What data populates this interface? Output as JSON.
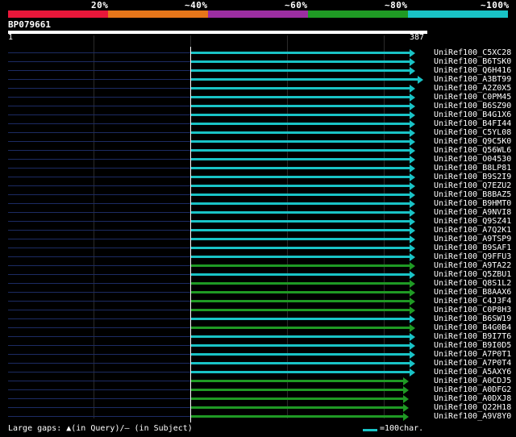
{
  "header": {
    "pct_labels": [
      "20%",
      "~40%",
      "~60%",
      "~80%",
      "~100%"
    ],
    "colors": [
      "#e8173a",
      "#e6761a",
      "#9c2ea1",
      "#1f9a24",
      "#19c3c6"
    ]
  },
  "query": {
    "id": "BP079661",
    "start": "1",
    "end": "387"
  },
  "hits": [
    {
      "label": "UniRef100_C5XC28",
      "color": "#19c3c6"
    },
    {
      "label": "UniRef100_B6TSK0",
      "color": "#19c3c6"
    },
    {
      "label": "UniRef100_Q6H416",
      "color": "#19c3c6"
    },
    {
      "label": "UniRef100_A3BT99",
      "color": "#19c3c6"
    },
    {
      "label": "UniRef100_A2Z0X5",
      "color": "#19c3c6"
    },
    {
      "label": "UniRef100_C0PM45",
      "color": "#19c3c6"
    },
    {
      "label": "UniRef100_B6SZ90",
      "color": "#19c3c6"
    },
    {
      "label": "UniRef100_B4G1X6",
      "color": "#19c3c6"
    },
    {
      "label": "UniRef100_B4FI44",
      "color": "#19c3c6"
    },
    {
      "label": "UniRef100_C5YL08",
      "color": "#19c3c6"
    },
    {
      "label": "UniRef100_Q9C5K0",
      "color": "#19c3c6"
    },
    {
      "label": "UniRef100_Q56WL6",
      "color": "#19c3c6"
    },
    {
      "label": "UniRef100_O04530",
      "color": "#19c3c6"
    },
    {
      "label": "UniRef100_B8LP81",
      "color": "#19c3c6"
    },
    {
      "label": "UniRef100_B9S2I9",
      "color": "#19c3c6"
    },
    {
      "label": "UniRef100_Q7EZU2",
      "color": "#19c3c6"
    },
    {
      "label": "UniRef100_B8BAZ5",
      "color": "#19c3c6"
    },
    {
      "label": "UniRef100_B9HMT0",
      "color": "#19c3c6"
    },
    {
      "label": "UniRef100_A9NVI8",
      "color": "#19c3c6"
    },
    {
      "label": "UniRef100_Q9SZ41",
      "color": "#19c3c6"
    },
    {
      "label": "UniRef100_A7Q2K1",
      "color": "#19c3c6"
    },
    {
      "label": "UniRef100_A9TSP9",
      "color": "#19c3c6"
    },
    {
      "label": "UniRef100_B9SAF1",
      "color": "#19c3c6"
    },
    {
      "label": "UniRef100_Q9FFU3",
      "color": "#19c3c6"
    },
    {
      "label": "UniRef100_A9TA22",
      "color": "#1f9a24"
    },
    {
      "label": "UniRef100_Q5ZBU1",
      "color": "#19c3c6"
    },
    {
      "label": "UniRef100_Q8S1L2",
      "color": "#1f9a24"
    },
    {
      "label": "UniRef100_B8AAX6",
      "color": "#1f9a24"
    },
    {
      "label": "UniRef100_C4J3F4",
      "color": "#1f9a24"
    },
    {
      "label": "UniRef100_C0P8H3",
      "color": "#1f9a24"
    },
    {
      "label": "UniRef100_B6SW19",
      "color": "#19c3c6"
    },
    {
      "label": "UniRef100_B4G0B4",
      "color": "#1f9a24"
    },
    {
      "label": "UniRef100_B9I7T6",
      "color": "#19c3c6"
    },
    {
      "label": "UniRef100_B9I0D5",
      "color": "#19c3c6"
    },
    {
      "label": "UniRef100_A7P0T1",
      "color": "#19c3c6"
    },
    {
      "label": "UniRef100_A7P0T4",
      "color": "#19c3c6"
    },
    {
      "label": "UniRef100_A5AXY6",
      "color": "#19c3c6"
    },
    {
      "label": "UniRef100_A0CDJ5",
      "color": "#1f9a24"
    },
    {
      "label": "UniRef100_A0DFG2",
      "color": "#1f9a24"
    },
    {
      "label": "UniRef100_A0DXJ8",
      "color": "#1f9a24"
    },
    {
      "label": "UniRef100_Q22H18",
      "color": "#1f9a24"
    },
    {
      "label": "UniRef100_A9V8Y0",
      "color": "#1f9a24"
    }
  ],
  "footer": {
    "legend": "Large gaps: ▲(in Query)/— (in Subject)",
    "scale_label": "=100char."
  }
}
